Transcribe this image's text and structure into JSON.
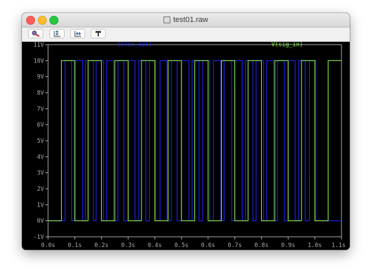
{
  "window": {
    "title": "test01.raw"
  },
  "toolbar": {
    "buttons": [
      "zoom-tool-icon",
      "autorange-y-icon",
      "autorange-x-icon",
      "probe-icon"
    ]
  },
  "chart_data": {
    "type": "line",
    "series": [
      {
        "name": "V(vco_out)",
        "color": "#2222ff",
        "x": [
          0,
          0.064,
          0.064,
          0.088,
          0.088,
          0.102,
          0.102,
          0.13,
          0.13,
          0.14,
          0.14,
          0.17,
          0.17,
          0.18,
          0.18,
          0.208,
          0.208,
          0.22,
          0.22,
          0.246,
          0.246,
          0.262,
          0.262,
          0.284,
          0.284,
          0.3,
          0.3,
          0.326,
          0.326,
          0.34,
          0.34,
          0.366,
          0.366,
          0.38,
          0.38,
          0.404,
          0.404,
          0.42,
          0.42,
          0.446,
          0.446,
          0.462,
          0.462,
          0.484,
          0.484,
          0.5,
          0.5,
          0.528,
          0.528,
          0.54,
          0.54,
          0.566,
          0.566,
          0.58,
          0.58,
          0.606,
          0.606,
          0.62,
          0.62,
          0.648,
          0.648,
          0.66,
          0.66,
          0.688,
          0.688,
          0.7,
          0.7,
          0.728,
          0.728,
          0.74,
          0.74,
          0.768,
          0.768,
          0.78,
          0.78,
          0.808,
          0.808,
          0.82,
          0.82,
          0.846,
          0.846,
          0.86,
          0.86,
          0.886,
          0.886,
          0.9,
          0.9,
          0.926,
          0.926,
          0.94,
          0.94,
          0.964,
          0.964,
          0.98,
          0.98,
          1.004,
          1.004,
          1.018,
          1.018,
          1.1
        ],
        "y": [
          0,
          0,
          10,
          10,
          0,
          0,
          10,
          10,
          0,
          0,
          10,
          10,
          0,
          0,
          10,
          10,
          0,
          0,
          10,
          10,
          0,
          0,
          10,
          10,
          0,
          0,
          10,
          10,
          0,
          0,
          10,
          10,
          0,
          0,
          10,
          10,
          0,
          0,
          10,
          10,
          0,
          0,
          10,
          10,
          0,
          0,
          10,
          10,
          0,
          0,
          10,
          10,
          0,
          0,
          10,
          10,
          0,
          0,
          10,
          10,
          0,
          0,
          10,
          10,
          0,
          0,
          10,
          10,
          0,
          0,
          10,
          10,
          0,
          0,
          10,
          10,
          0,
          0,
          10,
          10,
          0,
          0,
          10,
          10,
          0,
          0,
          10,
          10,
          0,
          0,
          10,
          10,
          0,
          0,
          10,
          10,
          0,
          0,
          0,
          0
        ]
      },
      {
        "name": "V(sig_in)",
        "color": "#88ee44",
        "x": [
          0,
          0.05,
          0.05,
          0.1,
          0.1,
          0.15,
          0.15,
          0.2,
          0.2,
          0.25,
          0.25,
          0.3,
          0.3,
          0.35,
          0.35,
          0.4,
          0.4,
          0.45,
          0.45,
          0.5,
          0.5,
          0.55,
          0.55,
          0.6,
          0.6,
          0.65,
          0.65,
          0.7,
          0.7,
          0.75,
          0.75,
          0.8,
          0.8,
          0.85,
          0.85,
          0.9,
          0.9,
          0.95,
          0.95,
          1.0,
          1.0,
          1.05,
          1.05,
          1.1
        ],
        "y": [
          0,
          0,
          10,
          10,
          0,
          0,
          10,
          10,
          0,
          0,
          10,
          10,
          0,
          0,
          10,
          10,
          0,
          0,
          10,
          10,
          0,
          0,
          10,
          10,
          0,
          0,
          10,
          10,
          0,
          0,
          10,
          10,
          0,
          0,
          10,
          10,
          0,
          0,
          10,
          10,
          0,
          0,
          10,
          10
        ]
      }
    ],
    "x_ticks": [
      "0.0s",
      "0.1s",
      "0.2s",
      "0.3s",
      "0.4s",
      "0.5s",
      "0.6s",
      "0.7s",
      "0.8s",
      "0.9s",
      "1.0s",
      "1.1s"
    ],
    "y_ticks": [
      "-1V",
      "0V",
      "1V",
      "2V",
      "3V",
      "4V",
      "5V",
      "6V",
      "7V",
      "8V",
      "9V",
      "10V",
      "11V"
    ],
    "xlim": [
      0,
      1.1
    ],
    "ylim": [
      -1,
      11
    ],
    "grid": false
  },
  "colors": {
    "background": "#000000",
    "axis": "#aaaaaa"
  }
}
